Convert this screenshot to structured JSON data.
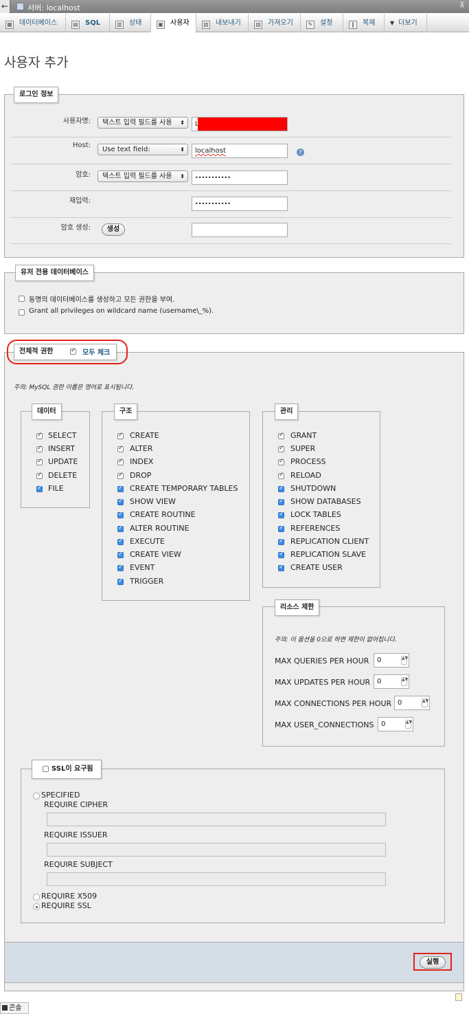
{
  "titlebar": {
    "title": "서버: localhost",
    "back_glyph": "←",
    "collapse_glyph": "⊼"
  },
  "tabs": [
    {
      "label": "데이터베이스",
      "icon": "database-icon",
      "glyph": "▦"
    },
    {
      "label": "SQL",
      "icon": "sql-icon",
      "glyph": "▤"
    },
    {
      "label": "상태",
      "icon": "status-icon",
      "glyph": "▥"
    },
    {
      "label": "사용자",
      "icon": "users-icon",
      "glyph": "▣"
    },
    {
      "label": "내보내기",
      "icon": "export-icon",
      "glyph": "▧"
    },
    {
      "label": "가져오기",
      "icon": "import-icon",
      "glyph": "▨"
    },
    {
      "label": "설정",
      "icon": "wrench-icon",
      "glyph": "✎"
    },
    {
      "label": "복제",
      "icon": "replication-icon",
      "glyph": "‖"
    },
    {
      "label": "더보기",
      "icon": "dropdown-icon",
      "glyph": "▼"
    }
  ],
  "page_title": "사용자 추가",
  "login": {
    "legend": "로그인 정보",
    "username_label": "사용자명:",
    "username_select": "텍스트 입력 필드를 사용",
    "username_value": "L",
    "host_label": "Host:",
    "host_select": "Use text field:",
    "host_value": "localhost",
    "password_label": "암호:",
    "password_select": "텍스트 입력 필드를 사용",
    "password_value": "•••••••••••",
    "reenter_label": "재입력:",
    "reenter_value": "•••••••••••",
    "generate_label": "암호 생성:",
    "generate_button": "생성",
    "help_glyph": "?"
  },
  "db_for_user": {
    "legend": "유저 전용 데이터베이스",
    "opt1": "동명의 데이터베이스를 생성하고 모든 권한을 부여.",
    "opt2": "Grant all privileges on wildcard name (username\\_%)."
  },
  "global_priv": {
    "legend": "전체적 권한",
    "check_all": "모두 체크",
    "note": "주의: MySQL 권한 이름은 영어로 표시됩니다.",
    "data": {
      "legend": "데이터",
      "items": [
        "SELECT",
        "INSERT",
        "UPDATE",
        "DELETE",
        "FILE"
      ]
    },
    "structure": {
      "legend": "구조",
      "items": [
        "CREATE",
        "ALTER",
        "INDEX",
        "DROP",
        "CREATE TEMPORARY TABLES",
        "SHOW VIEW",
        "CREATE ROUTINE",
        "ALTER ROUTINE",
        "EXECUTE",
        "CREATE VIEW",
        "EVENT",
        "TRIGGER"
      ]
    },
    "admin": {
      "legend": "관리",
      "items": [
        "GRANT",
        "SUPER",
        "PROCESS",
        "RELOAD",
        "SHUTDOWN",
        "SHOW DATABASES",
        "LOCK TABLES",
        "REFERENCES",
        "REPLICATION CLIENT",
        "REPLICATION SLAVE",
        "CREATE USER"
      ]
    }
  },
  "resource": {
    "legend": "리소스 제한",
    "note": "주의: 이 옵션을 0으로 하면 제한이 없어집니다.",
    "items": [
      {
        "label": "MAX QUERIES PER HOUR",
        "value": "0"
      },
      {
        "label": "MAX UPDATES PER HOUR",
        "value": "0"
      },
      {
        "label": "MAX CONNECTIONS PER HOUR",
        "value": "0"
      },
      {
        "label": "MAX USER_CONNECTIONS",
        "value": "0"
      }
    ],
    "spin_glyph": "▲▼"
  },
  "ssl": {
    "legend": "SSL이 요구됨",
    "specified": "SPECIFIED",
    "cipher": "REQUIRE CIPHER",
    "issuer": "REQUIRE ISSUER",
    "subject": "REQUIRE SUBJECT",
    "x509": "REQUIRE X509",
    "require_ssl": "REQUIRE SSL"
  },
  "go_button": "실행",
  "console": "콘솔",
  "colors": {
    "highlight": "#e2231a",
    "checked_blue": "#3d8ee8",
    "link": "#235a81"
  }
}
